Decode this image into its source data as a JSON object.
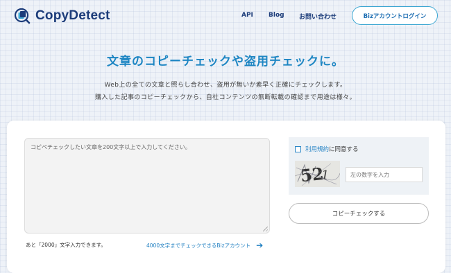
{
  "header": {
    "logo_text": "CopyDetect",
    "nav": [
      "API",
      "Blog",
      "お問い合わせ"
    ],
    "biz_login": "Bizアカウントログイン"
  },
  "hero": {
    "headline": "文章のコピーチェックや盗用チェックに。",
    "sub1": "Web上の全ての文章と照らし合わせ、盗用が無いか素早く正確にチェックします。",
    "sub2": "購入した記事のコピーチェックから、自社コンテンツの無断転載の確認まで用途は様々。"
  },
  "form": {
    "text_placeholder": "コピペチェックしたい文章を200文字以上で入力してください。",
    "remaining": "あと「2000」文字入力できます。",
    "biz_link": "4000文字までチェックできるBizアカウント",
    "terms_link": "利用規約",
    "terms_suffix": "に同意する",
    "captcha_placeholder": "左の数字を入力",
    "check_button": "コピーチェックする"
  }
}
